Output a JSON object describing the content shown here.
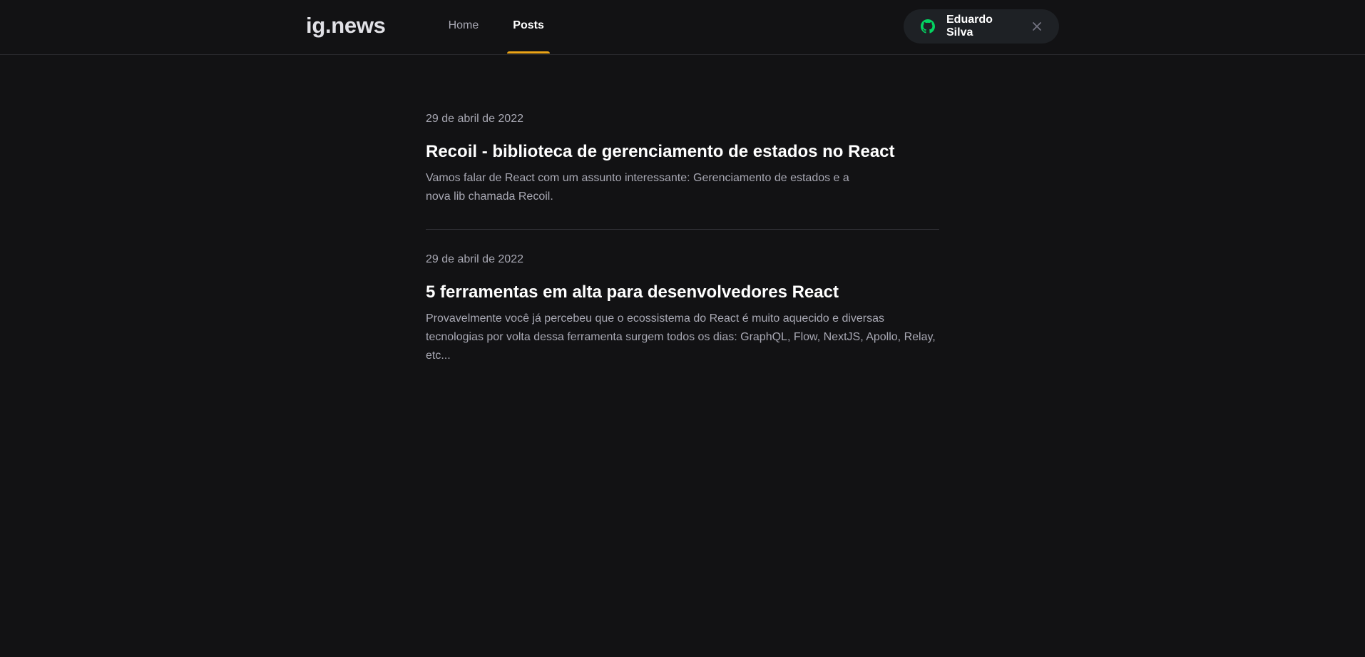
{
  "header": {
    "logo": "ig.news",
    "nav": [
      {
        "label": "Home",
        "active": false
      },
      {
        "label": "Posts",
        "active": true
      }
    ],
    "signin": {
      "icon": "github-icon",
      "user_name": "Eduardo Silva",
      "close_icon": "close-icon"
    }
  },
  "colors": {
    "background": "#121214",
    "accent": "#eba417",
    "github_green": "#04d361",
    "button_bg": "#1e2125",
    "muted_text": "#a8a8b3"
  },
  "posts": [
    {
      "date": "29 de abril de 2022",
      "title": "Recoil - biblioteca de gerenciamento de estados no React",
      "excerpt": "Vamos falar de React com um assunto interessante: Gerenciamento de estados e a nova lib chamada Recoil."
    },
    {
      "date": "29 de abril de 2022",
      "title": "5 ferramentas em alta para desenvolvedores React",
      "excerpt": "Provavelmente você já percebeu que o ecossistema do React é muito aquecido e diversas tecnologias por volta dessa ferramenta surgem todos os dias: GraphQL, Flow, NextJS, Apollo, Relay, etc..."
    }
  ]
}
